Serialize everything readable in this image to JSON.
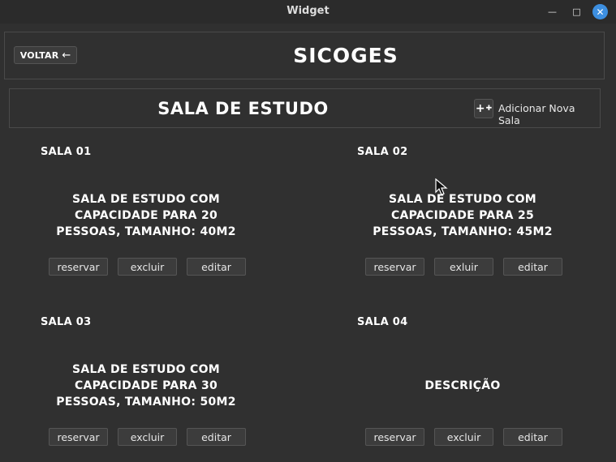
{
  "window": {
    "title": "Widget",
    "minimize": "—",
    "maximize": "□",
    "close": "✕"
  },
  "header": {
    "back_label": "VOLTAR",
    "back_arrow": "←",
    "app_title": "SICOGES"
  },
  "section": {
    "title": "SALA DE ESTUDO",
    "add_icon": "+",
    "add_icon_small": "✚",
    "add_label": "Adicionar Nova Sala"
  },
  "rooms": [
    {
      "name": "SALA 01",
      "description": "SALA DE ESTUDO COM\nCAPACIDADE PARA 20\nPESSOAS, TAMANHO: 40M2",
      "reserve": "reservar",
      "delete": "excluir",
      "edit": "editar"
    },
    {
      "name": "SALA 02",
      "description": "SALA DE ESTUDO COM\nCAPACIDADE PARA 25\nPESSOAS, TAMANHO: 45M2",
      "reserve": "reservar",
      "delete": "exluir",
      "edit": "editar"
    },
    {
      "name": "SALA 03",
      "description": "SALA DE ESTUDO COM\nCAPACIDADE PARA 30\nPESSOAS, TAMANHO: 50M2",
      "reserve": "reservar",
      "delete": "excluir",
      "edit": "editar"
    },
    {
      "name": "SALA 04",
      "description": "DESCRIÇÃO",
      "reserve": "reservar",
      "delete": "excluir",
      "edit": "editar"
    }
  ],
  "colors": {
    "background": "#303030",
    "button": "#3c3c3c",
    "close_button": "#3d8fe0"
  }
}
